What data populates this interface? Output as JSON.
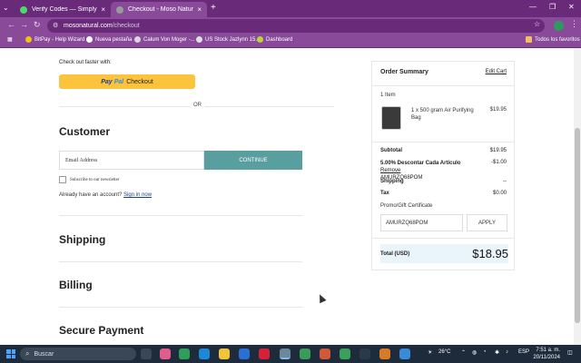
{
  "browser": {
    "tabs": [
      {
        "title": "Verify Codes — SimplyCodes",
        "close": "×"
      },
      {
        "title": "Checkout - Moso Natural",
        "close": "×"
      }
    ],
    "new_tab": "+",
    "window_controls": {
      "minimize": "—",
      "restore": "❐",
      "close": "✕"
    },
    "url_domain": "mosonatural.com",
    "url_path": "/checkout",
    "bookmarks": [
      {
        "label": "BitPay - Help Wizard",
        "color": "#f1c40f"
      },
      {
        "label": "Nueva pestaña",
        "color": "#ffffff"
      },
      {
        "label": "Calum Von Moger -...",
        "color": "#d8d8d8"
      },
      {
        "label": "US Stock Jazlynn 15...",
        "color": "#e0e0e0"
      },
      {
        "label": "Dashboard",
        "color": "#b7d63c"
      }
    ],
    "all_bookmarks": "Todos los favoritos"
  },
  "checkout": {
    "checkout_faster": "Check out faster with:",
    "paypal": {
      "pay": "Pay",
      "pal": "Pal",
      "label": "Checkout"
    },
    "or": "OR",
    "customer": {
      "title": "Customer",
      "email_placeholder": "Email Address",
      "continue": "CONTINUE",
      "newsletter": "Subscribe to our newsletter",
      "have_account": "Already have an account?",
      "sign_in": "Sign in now"
    },
    "shipping_title": "Shipping",
    "billing_title": "Billing",
    "payment_title": "Secure Payment"
  },
  "summary": {
    "title": "Order Summary",
    "edit": "Edit Cart",
    "items_count": "1 Item",
    "product_name": "1 x 500 gram Air Purifying Bag",
    "product_price": "$19.95",
    "subtotal_label": "Subtotal",
    "subtotal": "$19.95",
    "discount_label": "5.00% Descontar Cada Artículo",
    "discount_remove": "Remove",
    "discount_code": "AMURZQ68POM",
    "discount_amount": "-$1.00",
    "shipping_label": "Shipping",
    "shipping": "--",
    "tax_label": "Tax",
    "tax": "$0.00",
    "promo_label": "Promo/Gift Certificate",
    "promo_value": "AMURZQ68POM",
    "apply": "APPLY",
    "total_label": "Total (USD)",
    "total": "$18.95"
  },
  "taskbar": {
    "search": "Buscar",
    "weather": "26°C",
    "lang": "ESP",
    "time": "7:51 a. m.",
    "date": "20/11/2024"
  },
  "colors": {
    "browser_frame": "#6a2a7a",
    "toolbar": "#8a4a9a",
    "paypal_button": "#fbc43c",
    "continue_button": "#5a9fa0",
    "total_highlight": "#eaf4fb"
  }
}
